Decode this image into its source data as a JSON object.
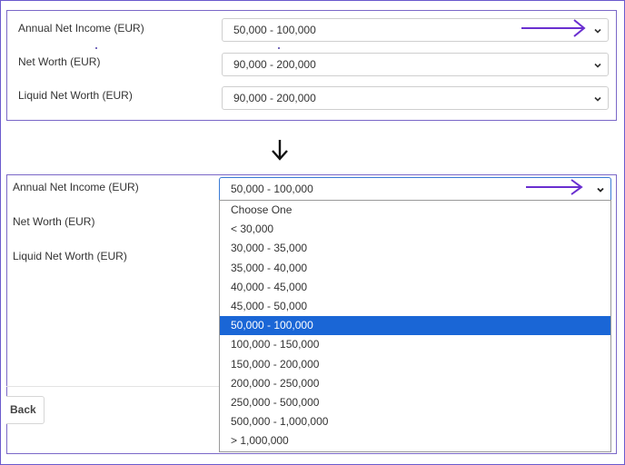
{
  "top_form": {
    "annual_label": "Annual Net Income (EUR)",
    "annual_value": "50,000 - 100,000",
    "networth_label": "Net Worth (EUR)",
    "networth_value": "90,000 - 200,000",
    "liquid_label": "Liquid Net Worth (EUR)",
    "liquid_value": "90,000 - 200,000"
  },
  "bottom_form": {
    "annual_label": "Annual Net Income (EUR)",
    "annual_value": "50,000 - 100,000",
    "networth_label": "Net Worth (EUR)",
    "liquid_label": "Liquid Net Worth (EUR)",
    "back_label": "Back"
  },
  "dropdown": {
    "options": [
      "Choose One",
      "< 30,000",
      "30,000 - 35,000",
      "35,000 - 40,000",
      "40,000 - 45,000",
      "45,000 - 50,000",
      "50,000 - 100,000",
      "100,000 - 150,000",
      "150,000 - 200,000",
      "200,000 - 250,000",
      "250,000 - 500,000",
      "500,000 - 1,000,000",
      "> 1,000,000"
    ],
    "selected_option": "50,000 - 100,000"
  },
  "colors": {
    "annotation": "#6a2fd0",
    "selected_bg": "#1a66d6",
    "frame": "#7b68c8"
  },
  "icons": {
    "chevron": "chevron-down-icon",
    "annotation_arrow": "right-arrow-icon",
    "transition_arrow": "down-arrow-icon"
  }
}
